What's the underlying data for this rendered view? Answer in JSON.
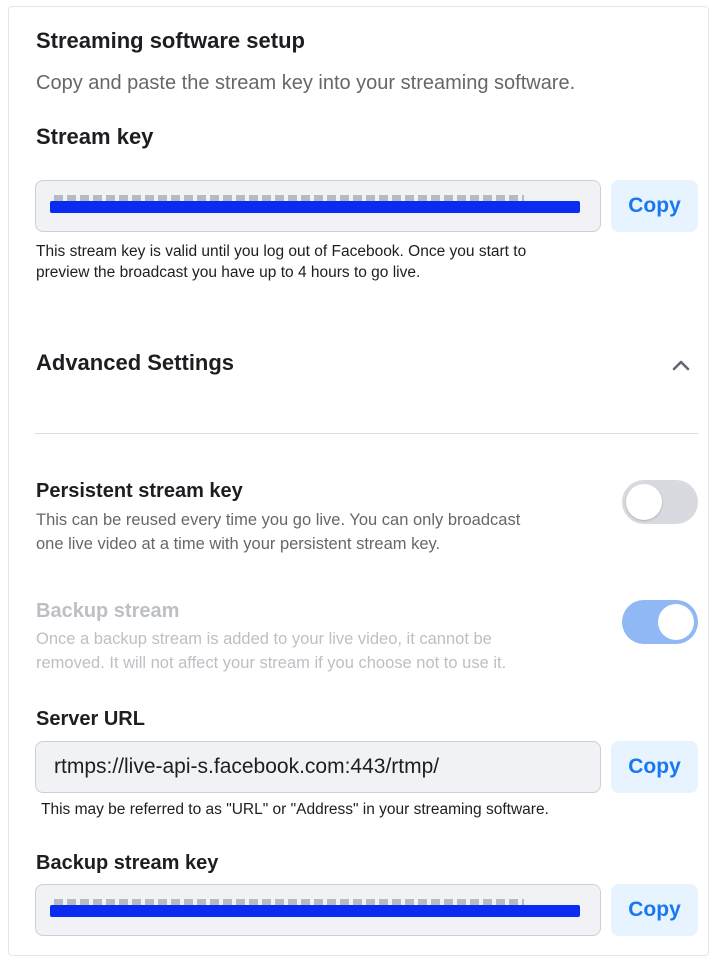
{
  "header": {
    "title": "Streaming software setup",
    "subtitle": "Copy and paste the stream key into your streaming software."
  },
  "stream_key": {
    "label": "Stream key",
    "copy_label": "Copy",
    "help_line1": "This stream key is valid until you log out of Facebook. Once you start to",
    "help_line2": "preview the broadcast you have up to 4 hours to go live."
  },
  "advanced": {
    "title": "Advanced Settings",
    "expanded": true,
    "chevron_icon": "chevron-up-icon"
  },
  "persistent_key": {
    "title": "Persistent stream key",
    "desc_line1": "This can be reused every time you go live. You can only broadcast",
    "desc_line2": "one live video at a time with your persistent stream key.",
    "enabled": false
  },
  "backup_stream": {
    "title": "Backup stream",
    "desc_line1": "Once a backup stream is added to your live video, it cannot be",
    "desc_line2": "removed. It will not affect your stream if you choose not to use it.",
    "enabled": true,
    "disabled_state": true
  },
  "server_url": {
    "label": "Server URL",
    "value": "rtmps://live-api-s.facebook.com:443/rtmp/",
    "copy_label": "Copy",
    "help": "This may be referred to as \"URL\" or \"Address\" in your streaming software."
  },
  "backup_key": {
    "label": "Backup stream key",
    "copy_label": "Copy"
  },
  "colors": {
    "accent": "#1877f2",
    "copy_bg": "#e7f3ff",
    "field_bg": "#f0f2f5",
    "toggle_on_disabled": "#8fb8f5",
    "toggle_off": "#d8dadf",
    "redaction": "#0a2cf0"
  }
}
